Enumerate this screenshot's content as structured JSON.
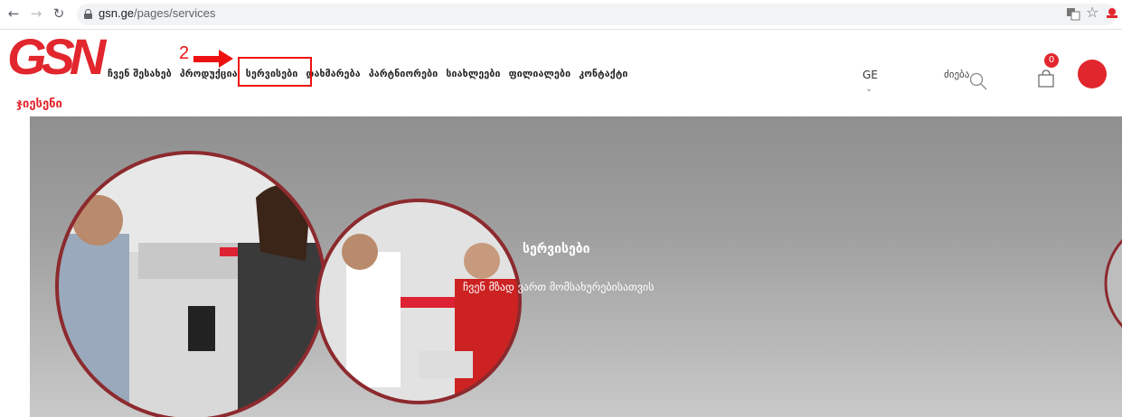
{
  "browser": {
    "url_host": "gsn.ge",
    "url_path": "/pages/services"
  },
  "site": {
    "logo_text": "GSN",
    "logo_subtitle": "ჯიესენი",
    "nav": [
      "ჩვენ შესახებ",
      "პროდუქცია",
      "სერვისები",
      "დახმარება",
      "პარტნიორები",
      "სიახლეები",
      "ფილიალები",
      "კონტაქტი"
    ],
    "language": "GE",
    "search_label": "ძიება",
    "cart_count": "0"
  },
  "annotation": {
    "step_number": "2"
  },
  "hero": {
    "title": "სერვისები",
    "subtitle": "ჩვენ მზად ვართ მომსახურებისათვის"
  },
  "colors": {
    "brand_red": "#e1262d"
  }
}
